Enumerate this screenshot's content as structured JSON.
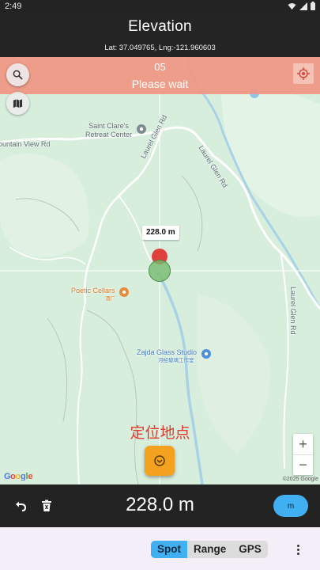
{
  "status_bar": {
    "time": "2:49"
  },
  "header": {
    "title": "Elevation",
    "coordinates": "Lat: 37.049765, Lng:-121.960603"
  },
  "loading": {
    "counter": "05",
    "message": "Please wait"
  },
  "map": {
    "labels": {
      "retreat": "Saint Clare's\nRetreat Center",
      "mountain_view": "ountain View Rd",
      "laurel_glen_1": "Laurel Glen Rd",
      "laurel_glen_2": "Laurel Glen Rd",
      "laurel_glen_3": "Laurel Glen Rd",
      "poetic_cellars": "Poetic Cellars",
      "poetic_cellars_cn": "酒厂",
      "glass_studio": "Zajda Glass Studio",
      "glass_studio_cn": "河经玻璃工作室"
    },
    "marker_elevation": "228.0 m",
    "location_caption": "定位地点",
    "zoom_in": "+",
    "zoom_out": "−",
    "google_logo": "Google",
    "copyright": "©2025 Google"
  },
  "bottom_bar": {
    "elevation": "228.0 m",
    "unit_button": "m"
  },
  "mode_tabs": [
    "Spot",
    "Range",
    "GPS"
  ],
  "colors": {
    "accent": "#41b0f2",
    "banner": "#f09682",
    "fab": "#f3a11f",
    "pin_red": "#e0403d",
    "caption": "#e2382c"
  },
  "icons": {
    "search": "search-icon",
    "map_layers": "map-icon",
    "locate": "my-location-icon",
    "undo": "undo-icon",
    "delete": "delete-icon",
    "more": "more-vert-icon"
  }
}
